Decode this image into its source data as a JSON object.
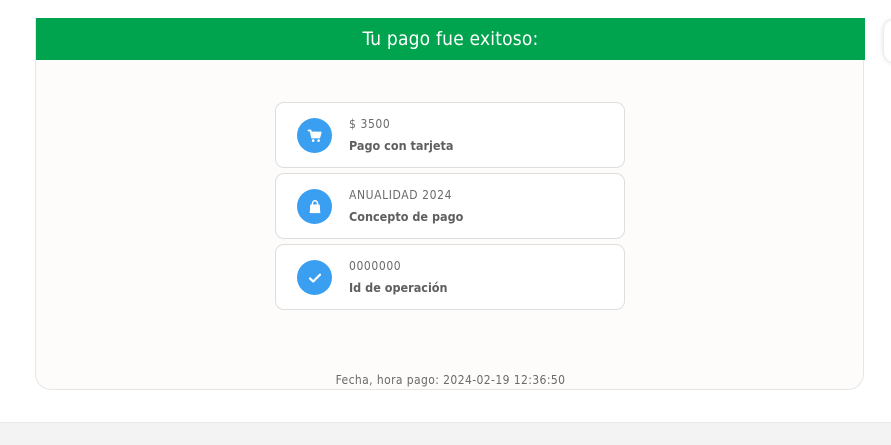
{
  "header": {
    "title": "Tu pago fue exitoso:"
  },
  "colors": {
    "header_bg": "#00a44e",
    "icon_bg": "#3a9ff0"
  },
  "items": [
    {
      "icon": "shopping-cart-icon",
      "value": "$ 3500",
      "label": "Pago con tarjeta"
    },
    {
      "icon": "shopping-bag-icon",
      "value": "ANUALIDAD 2024",
      "label": "Concepto de pago"
    },
    {
      "icon": "check-icon",
      "value": "0000000",
      "label": "Id de operación"
    }
  ],
  "footer": {
    "timestamp_label": "Fecha, hora pago:",
    "timestamp_value": "2024-02-19 12:36:50"
  }
}
